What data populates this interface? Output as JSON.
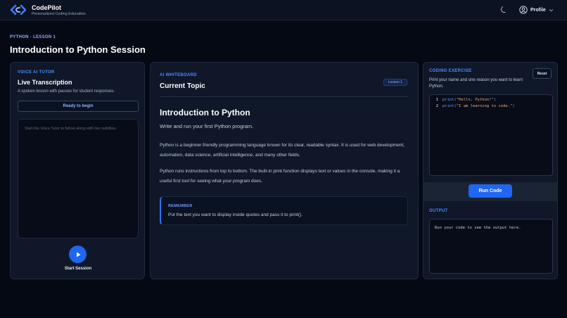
{
  "header": {
    "brand": "CodePilot",
    "tagline": "Personalized Coding Education",
    "profile_label": "Profile"
  },
  "breadcrumb": "PYTHON · LESSON 1",
  "page_title": "Introduction to Python Session",
  "voice": {
    "section_label": "VOICE AI TUTOR",
    "title": "Live Transcription",
    "subtitle": "A spoken lesson with pauses for student responses.",
    "status_button": "Ready to begin",
    "placeholder": "Start the Voice Tutor to follow along with live subtitles.",
    "start_label": "Start Session"
  },
  "whiteboard": {
    "section_label": "AI WHITEBOARD",
    "title": "Current Topic",
    "badge": "Lesson 1",
    "topic_title": "Introduction to Python",
    "topic_subtitle": "Write and run your first Python program.",
    "paragraph1": "Python is a beginner-friendly programming language known for its clear, readable syntax. It is used for web development, automation, data science, artificial intelligence, and many other fields.",
    "paragraph2": "Python runs instructions from top to bottom. The built-in print function displays text or values in the console, making it a useful first tool for seeing what your program does.",
    "remember_label": "REMEMBER",
    "remember_text": "Put the text you want to display inside quotes and pass it to print()."
  },
  "exercise": {
    "section_label": "CODING EXERCISE",
    "reset_label": "Reset",
    "prompt": "Print your name and one reason you want to learn Python.",
    "code_lines": [
      {
        "num": "1",
        "fn": "print(",
        "str": "\"Hello, Python!\"",
        "end": ")"
      },
      {
        "num": "2",
        "fn": "print(",
        "str": "\"I am learning to code.\"",
        "end": ")"
      }
    ],
    "run_label": "Run Code",
    "output_label": "OUTPUT",
    "output_placeholder": "Run your code to see the output here."
  },
  "colors": {
    "accent": "#1f66f2",
    "background": "#050914",
    "card": "#0f1728",
    "label_blue": "#4d8dff",
    "string": "#e8b07a"
  },
  "icons": {
    "logo": "code-brackets-logo-icon",
    "theme": "moon-icon",
    "profile": "user-circle-icon",
    "profile_menu": "chevron-down-icon",
    "start": "play-icon"
  }
}
